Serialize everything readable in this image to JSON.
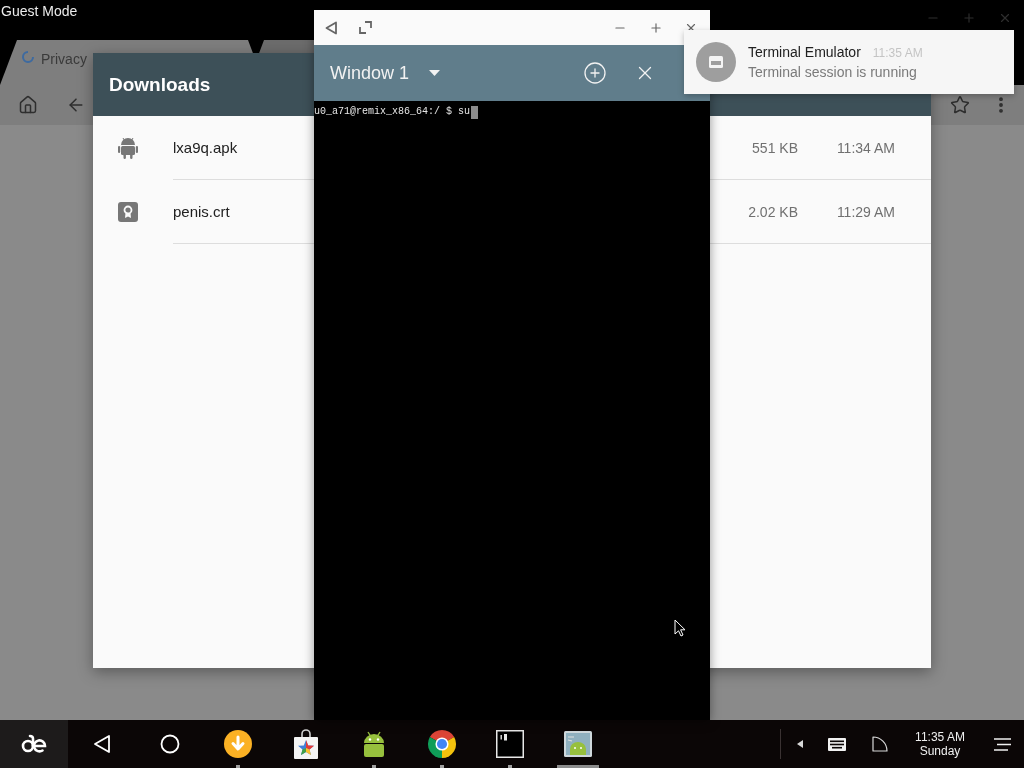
{
  "browser": {
    "title": "Guest Mode",
    "tabs": [
      {
        "label": "Privacy",
        "selected": true
      },
      {
        "selected": false
      }
    ]
  },
  "downloads": {
    "title": "Downloads",
    "items": [
      {
        "kind": "apk",
        "name": "lxa9q.apk",
        "size": "551 KB",
        "time": "11:34 AM"
      },
      {
        "kind": "certificate",
        "name": "penis.crt",
        "size": "2.02 KB",
        "time": "11:29 AM"
      }
    ]
  },
  "terminal": {
    "window_name": "Window 1",
    "lines": [
      "u0_a71@remix_x86_64:/ $ su"
    ]
  },
  "notification": {
    "app": "Terminal Emulator",
    "time": "11:35 AM",
    "text": "Terminal session is running"
  },
  "taskbar": {
    "apps": [
      {
        "kind": "downloader",
        "running": true,
        "selected": false
      },
      {
        "kind": "store",
        "running": false,
        "selected": false
      },
      {
        "kind": "android",
        "running": true,
        "selected": false
      },
      {
        "kind": "browser",
        "running": true,
        "selected": false
      },
      {
        "kind": "terminal",
        "running": true,
        "selected": false
      },
      {
        "kind": "gallery",
        "running": true,
        "selected": true
      }
    ],
    "clock": {
      "time": "11:35 AM",
      "day": "Sunday"
    }
  }
}
